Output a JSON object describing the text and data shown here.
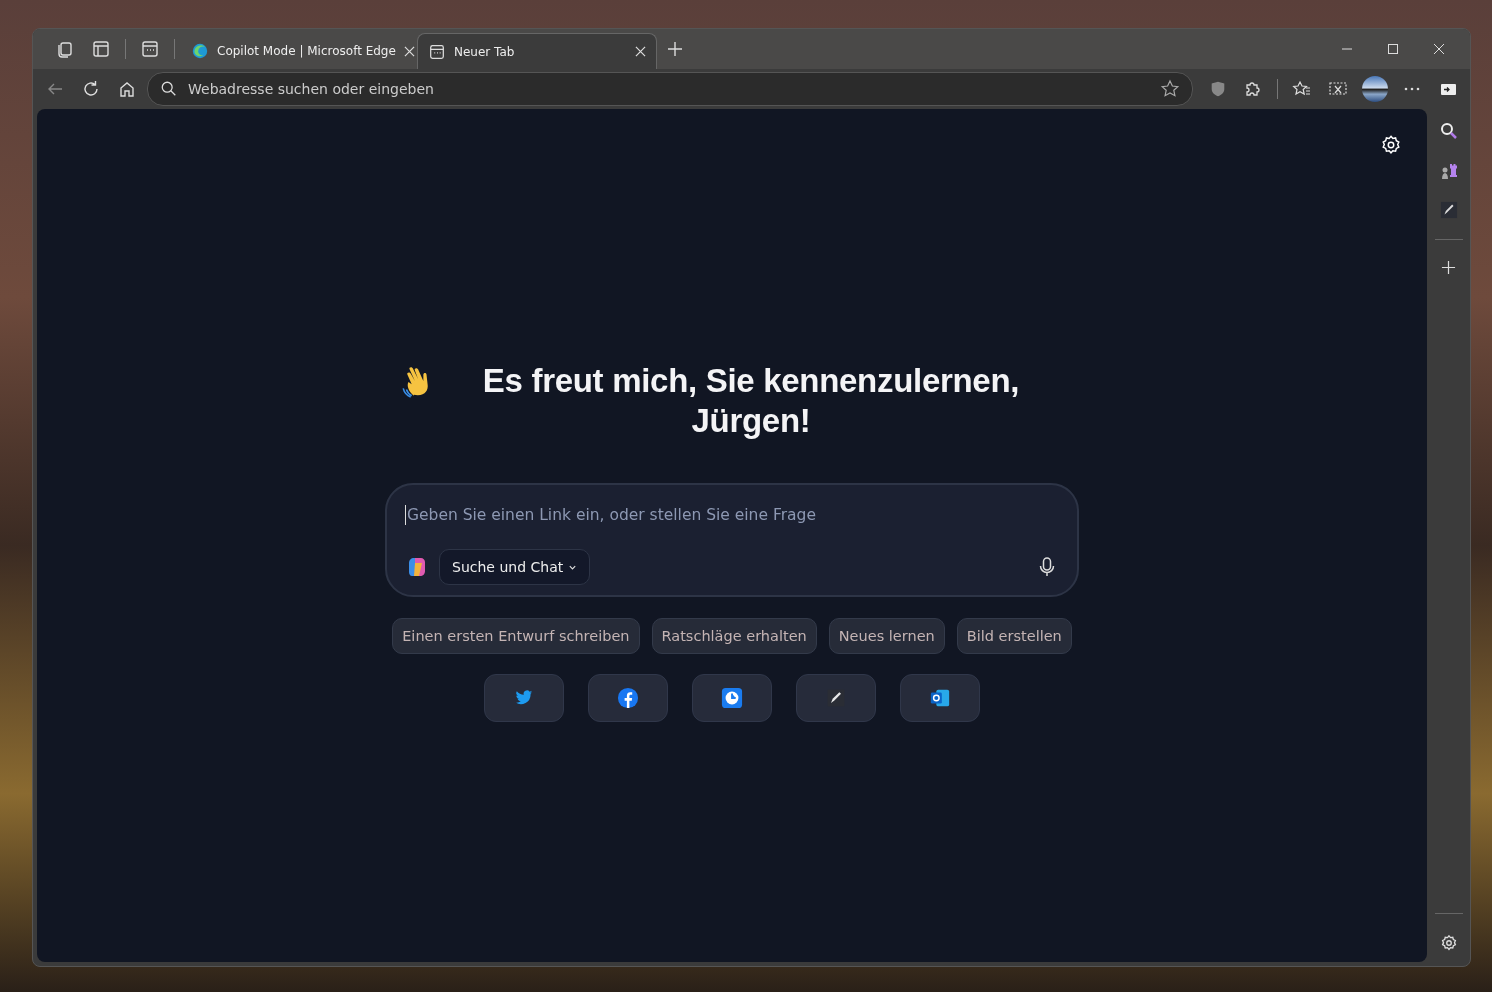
{
  "tabs": [
    {
      "title": "Copilot Mode | Microsoft Edge",
      "selected": false,
      "kind": "edge"
    },
    {
      "title": "Neuer Tab",
      "selected": true,
      "kind": "page"
    }
  ],
  "address_bar": {
    "placeholder": "Webadresse suchen oder eingeben"
  },
  "greeting": "Es freut mich, Sie kennenzulernen, Jürgen!",
  "composer": {
    "placeholder": "Geben Sie einen Link ein, oder stellen Sie eine Frage",
    "mode": "Suche und Chat"
  },
  "suggestions": [
    "Einen ersten Entwurf schreiben",
    "Ratschläge erhalten",
    "Neues lernen",
    "Bild erstellen"
  ],
  "quick_links": [
    {
      "kind": "bird"
    },
    {
      "kind": "facebook"
    },
    {
      "kind": "clock"
    },
    {
      "kind": "pen"
    },
    {
      "kind": "mail"
    }
  ]
}
